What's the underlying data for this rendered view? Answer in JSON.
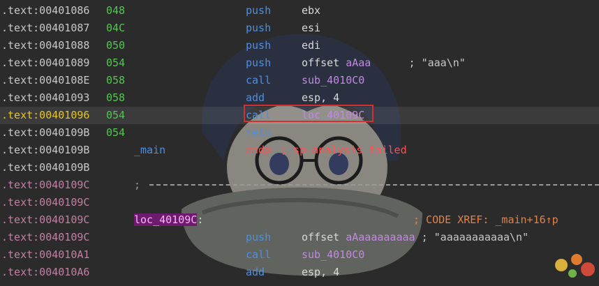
{
  "colors": {
    "addr_gray": "#c8c8c8",
    "addr_pink": "#c47fa4",
    "addr_current": "#e8c51c",
    "stack_green": "#4ec94e",
    "mnemonic_blue": "#4f8fe0",
    "symbol_purple": "#c08ae0",
    "error_red": "#ff5252",
    "comment_orange": "#e0824a",
    "highlight_box": "#d3302f"
  },
  "lines": [
    {
      "addr": ".text:00401086",
      "sp": "048",
      "mnem": "push",
      "op": "ebx"
    },
    {
      "addr": ".text:00401087",
      "sp": "04C",
      "mnem": "push",
      "op": "esi"
    },
    {
      "addr": ".text:00401088",
      "sp": "050",
      "mnem": "push",
      "op": "edi"
    },
    {
      "addr": ".text:00401089",
      "sp": "054",
      "mnem": "push",
      "op_pre": "offset ",
      "op_sym": "aAaa",
      "comment": "; \"aaa\\n\""
    },
    {
      "addr": ".text:0040108E",
      "sp": "058",
      "mnem": "call",
      "op_sym": "sub_4010C0"
    },
    {
      "addr": ".text:00401093",
      "sp": "058",
      "mnem": "add",
      "op": "esp, 4"
    },
    {
      "addr": ".text:00401096",
      "sp": "054",
      "mnem": "call",
      "op_sym": "loc_40109C"
    },
    {
      "addr": ".text:0040109B",
      "sp": "054",
      "mnem": "retn"
    },
    {
      "addr": ".text:0040109B",
      "label": "_main",
      "endp": "endp",
      "endp_comment": "; sp-analysis failed"
    },
    {
      "addr": ".text:0040109B"
    },
    {
      "addr": ".text:0040109C",
      "separator": ";"
    },
    {
      "addr": ".text:0040109C"
    },
    {
      "addr": ".text:0040109C",
      "label_hl": "loc_40109C",
      "label_colon": ":",
      "xref": "; CODE XREF: _main+16↑p"
    },
    {
      "addr": ".text:0040109C",
      "mnem": "push",
      "op_pre": "offset ",
      "op_sym": "aAaaaaaaaaa",
      "comment": "; \"aaaaaaaaaaa\\n\""
    },
    {
      "addr": ".text:004010A1",
      "mnem": "call",
      "op_sym": "sub_4010C0"
    },
    {
      "addr": ".text:004010A6",
      "mnem": "add",
      "op": "esp, 4"
    }
  ]
}
